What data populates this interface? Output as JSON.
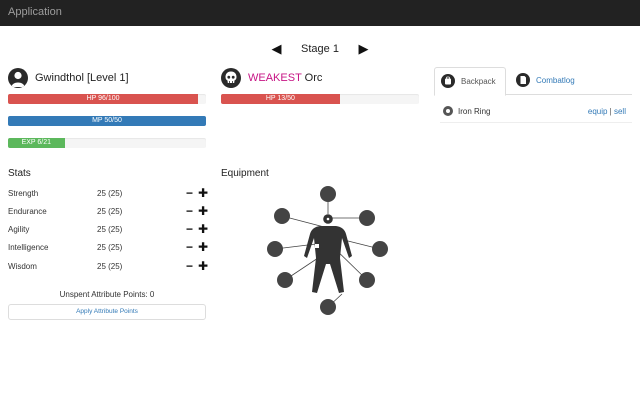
{
  "navbar": {
    "brand": "Application"
  },
  "stage": {
    "prev": "◀",
    "label": "Stage 1",
    "next": "▶"
  },
  "player": {
    "name": "Gwindthol [Level 1]",
    "bars": [
      {
        "id": "hp",
        "label": "HP 96/100",
        "fill": 0.96,
        "color": "#d9534f"
      },
      {
        "id": "mp",
        "label": "MP 50/50",
        "fill": 1.0,
        "color": "#337ab7"
      },
      {
        "id": "exp",
        "label": "EXP 6/21",
        "fill": 0.286,
        "color": "#5cb85c"
      }
    ]
  },
  "enemy": {
    "prefix": "WEAKEST",
    "name": " Orc",
    "hp": {
      "label": "HP 13/50",
      "fill": 0.6,
      "color": "#d9534f"
    }
  },
  "stats": {
    "title": "Stats",
    "rows": [
      {
        "name": "Strength",
        "value": "25 (25)"
      },
      {
        "name": "Endurance",
        "value": "25 (25)"
      },
      {
        "name": "Agility",
        "value": "25 (25)"
      },
      {
        "name": "Intelligence",
        "value": "25 (25)"
      },
      {
        "name": "Wisdom",
        "value": "25 (25)"
      }
    ],
    "minus": "−",
    "plus": "✚",
    "unspent": "Unspent Attribute Points: 0",
    "apply": "Apply Attribute Points"
  },
  "equipment": {
    "title": "Equipment"
  },
  "tabs": [
    {
      "label": "Backpack",
      "icon": "backpack-icon"
    },
    {
      "label": "Combatlog",
      "icon": "document-icon"
    }
  ],
  "inventory": [
    {
      "name": "Iron Ring",
      "equip": "equip",
      "sep": " | ",
      "sell": "sell"
    }
  ]
}
